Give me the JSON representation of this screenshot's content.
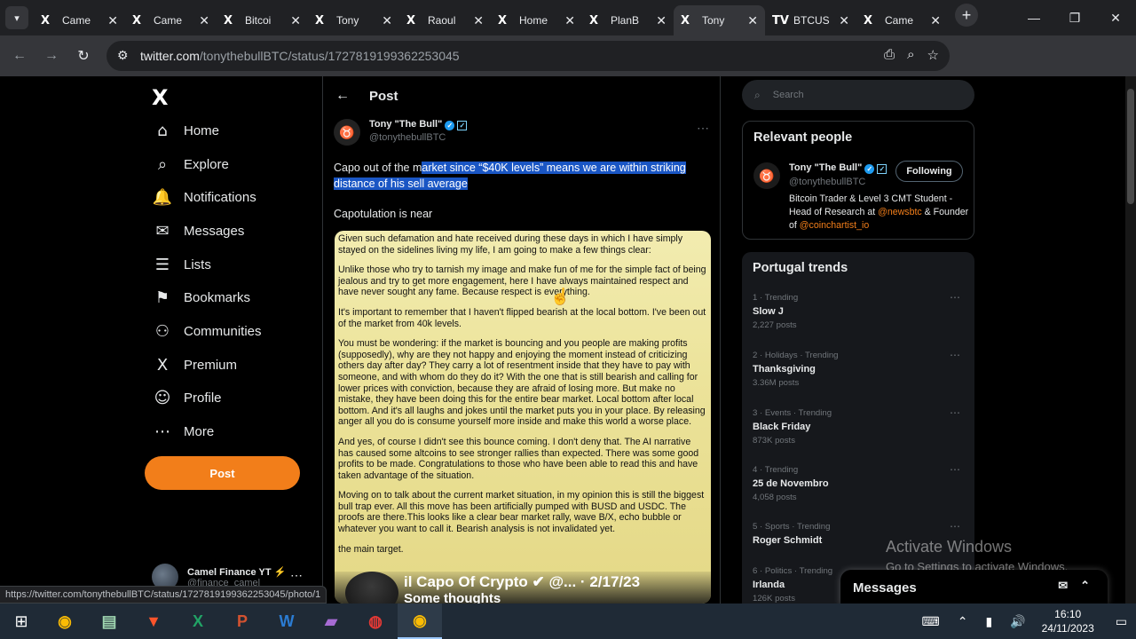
{
  "browser": {
    "tabs": [
      {
        "icon": "X",
        "title": "Came"
      },
      {
        "icon": "X",
        "title": "Came"
      },
      {
        "icon": "X",
        "title": "Bitcoi"
      },
      {
        "icon": "X",
        "title": "Tony"
      },
      {
        "icon": "X",
        "title": "Raoul"
      },
      {
        "icon": "X",
        "title": "Home"
      },
      {
        "icon": "X",
        "title": "PlanB"
      },
      {
        "icon": "X",
        "title": "Tony"
      },
      {
        "icon": "TV",
        "title": "BTCUS"
      },
      {
        "icon": "X",
        "title": "Came"
      }
    ],
    "url_host": "twitter.com",
    "url_path": "/tonythebullBTC/status/1727819199362253045",
    "status_url": "https://twitter.com/tonythebullBTC/status/1727819199362253045/photo/1"
  },
  "nav": {
    "items": [
      {
        "icon": "home-icon",
        "glyph": "⌂",
        "label": "Home"
      },
      {
        "icon": "search-icon",
        "glyph": "⌕",
        "label": "Explore"
      },
      {
        "icon": "bell-icon",
        "glyph": "🔔",
        "label": "Notifications"
      },
      {
        "icon": "mail-icon",
        "glyph": "✉",
        "label": "Messages"
      },
      {
        "icon": "list-icon",
        "glyph": "☰",
        "label": "Lists"
      },
      {
        "icon": "bookmark-icon",
        "glyph": "⚑",
        "label": "Bookmarks"
      },
      {
        "icon": "communities-icon",
        "glyph": "⚇",
        "label": "Communities"
      },
      {
        "icon": "premium-icon",
        "glyph": "X",
        "label": "Premium"
      },
      {
        "icon": "profile-icon",
        "glyph": "☺",
        "label": "Profile"
      },
      {
        "icon": "more-icon",
        "glyph": "⋯",
        "label": "More"
      }
    ],
    "post_label": "Post",
    "account_name": "Camel Finance YT ⚡",
    "account_handle": "@finance_camel"
  },
  "post": {
    "header": "Post",
    "author_name": "Tony \"The Bull\"",
    "author_handle": "@tonythebullBTC",
    "text_plain": "Capo out of the m",
    "text_highlight": "arket since “$40K levels” means we are within striking distance of his sell average",
    "text2": "Capotulation is near",
    "image_paragraphs": [
      "Given such defamation and hate received during these days in which I have simply stayed on the sidelines living my life, I am going to make a few things clear:",
      "Unlike those who try to tarnish my image and make fun of me for the simple fact of being jealous and try to get more engagement, here I have always maintained respect and have never sought any fame. Because respect is everything.",
      "It's important to remember that I haven't flipped bearish at the local bottom. I've been out of the market from 40k levels.",
      "You must be wondering: if the market is bouncing and you people are making profits (supposedly), why are they not happy and enjoying the moment instead of criticizing others day after day? They carry a lot of resentment inside that they have to pay with someone, and with whom do they do it? With the one that is still bearish and calling for lower prices with conviction, because they are afraid of losing more. But make no mistake, they have been doing this for the entire bear market. Local bottom after local bottom. And it's all laughs and jokes until the market puts you in your place. By releasing anger all you do is consume yourself more inside and make this world a worse place.",
      "And yes, of course I didn't see this bounce coming. I don't deny that. The AI narrative has caused some altcoins to see stronger rallies than expected. There was some good profits to be made. Congratulations to those who have been able to read this and have taken advantage of the situation.",
      "Moving on to talk about the current market situation, in my opinion this is still the biggest bull trap ever. All this move has been artificially pumped with BUSD and USDC. The proofs are there.This looks like a clear bear market rally, wave B/X, echo bubble or whatever you want to call it. Bearish analysis is not invalidated yet.",
      "the main target."
    ],
    "image_caption": "il Capo Of Crypto ✔ @... · 2/17/23",
    "image_sub": "Some thoughts"
  },
  "right": {
    "search_placeholder": "Search",
    "relevant_title": "Relevant people",
    "person_name": "Tony \"The Bull\"",
    "person_handle": "@tonythebullBTC",
    "following_label": "Following",
    "bio_text": "Bitcoin Trader & Level 3 CMT Student - Head of Research at ",
    "bio_link1": "@newsbtc",
    "bio_mid": " & Founder of ",
    "bio_link2": "@coinchartist_io",
    "trends_title": "Portugal trends",
    "trends": [
      {
        "meta": "1 · Trending",
        "name": "Slow J",
        "posts": "2,227 posts"
      },
      {
        "meta": "2 · Holidays · Trending",
        "name": "Thanksgiving",
        "posts": "3.36M posts"
      },
      {
        "meta": "3 · Events · Trending",
        "name": "Black Friday",
        "posts": "873K posts"
      },
      {
        "meta": "4 · Trending",
        "name": "25 de Novembro",
        "posts": "4,058 posts"
      },
      {
        "meta": "5 · Sports · Trending",
        "name": "Roger Schmidt",
        "posts": ""
      },
      {
        "meta": "6 · Politics · Trending",
        "name": "Irlanda",
        "posts": "126K posts"
      }
    ],
    "messages_label": "Messages"
  },
  "watermark": {
    "line1": "Activate Windows",
    "line2": "Go to Settings to activate Windows."
  },
  "taskbar": {
    "time": "16:10",
    "date": "24/11/2023"
  }
}
